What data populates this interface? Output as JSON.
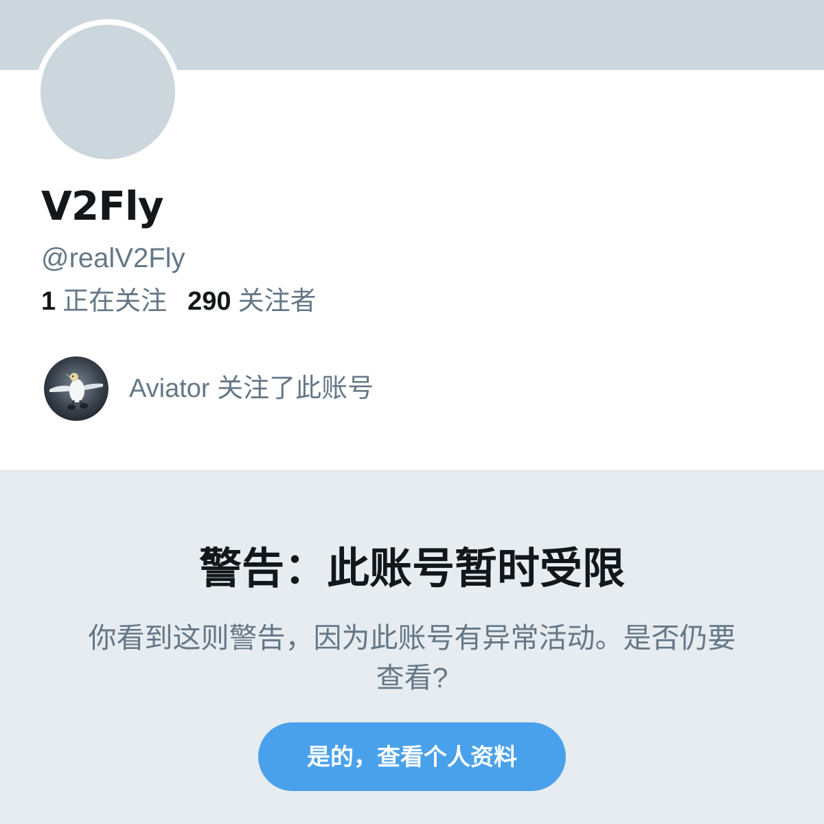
{
  "profile": {
    "display_name": "V2Fly",
    "handle": "@realV2Fly",
    "stats": {
      "following_count": "1",
      "following_label": "正在关注",
      "followers_count": "290",
      "followers_label": "关注者"
    },
    "followed_by": {
      "text": "Aviator 关注了此账号",
      "avatar_icon": "gannet-bird-photo"
    }
  },
  "warning": {
    "title": "警告：此账号暂时受限",
    "body": "你看到这则警告，因为此账号有异常活动。是否仍要查看?",
    "button_label": "是的，查看个人资料"
  },
  "colors": {
    "banner": "#ccd6dd",
    "panel": "#e6ecf0",
    "accent": "#4aa1eb",
    "primary_text": "#14171a",
    "secondary_text": "#657786"
  }
}
